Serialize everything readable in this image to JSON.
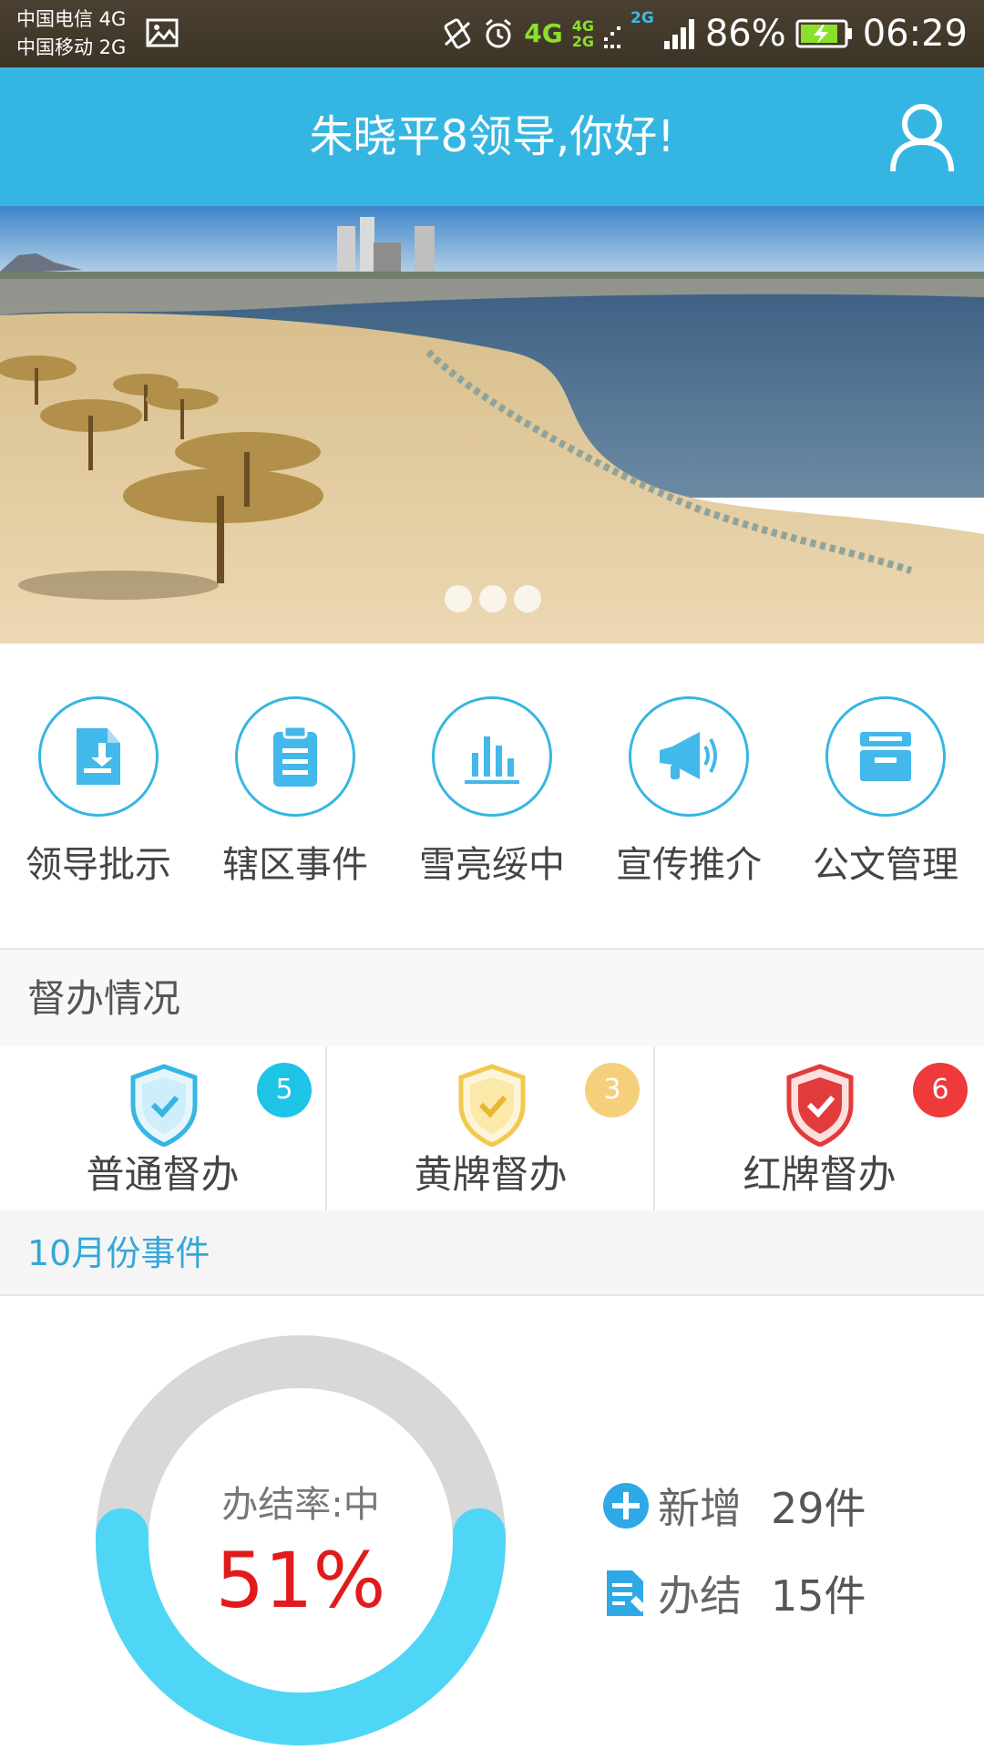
{
  "status_bar": {
    "carrier_1": "中国电信 4G",
    "carrier_2": "中国移动 2G",
    "net_4g": "4G",
    "net_stack_top": "4G",
    "net_stack_bottom": "2G",
    "net_2g": "2G",
    "battery": "86%",
    "time": "06:29"
  },
  "header": {
    "title": "朱晓平8领导,你好!"
  },
  "banner": {
    "slide_count": 3
  },
  "quick_nav": [
    {
      "label": "领导批示",
      "icon": "download-document-icon"
    },
    {
      "label": "辖区事件",
      "icon": "clipboard-icon"
    },
    {
      "label": "雪亮绥中",
      "icon": "bar-chart-icon"
    },
    {
      "label": "宣传推介",
      "icon": "megaphone-icon"
    },
    {
      "label": "公文管理",
      "icon": "archive-box-icon"
    }
  ],
  "supervision": {
    "title": "督办情况",
    "items": [
      {
        "label": "普通督办",
        "count": "5",
        "color": "#1ec3e8",
        "shield_color": "#35b6e2"
      },
      {
        "label": "黄牌督办",
        "count": "3",
        "color": "#f6cf7a",
        "shield_color": "#f2c94c"
      },
      {
        "label": "红牌督办",
        "count": "6",
        "color": "#ee3a3a",
        "shield_color": "#e23b3b"
      }
    ]
  },
  "month": {
    "title": "10月份事件",
    "rate_label": "办结率:中",
    "rate_value": "51%",
    "rate_fraction": 0.51,
    "ring_fill_color": "#4fd6f7",
    "ring_track_color": "#d8d8d8",
    "new_label": "新增",
    "new_value": "29件",
    "closed_label": "办结",
    "closed_value": "15件"
  }
}
